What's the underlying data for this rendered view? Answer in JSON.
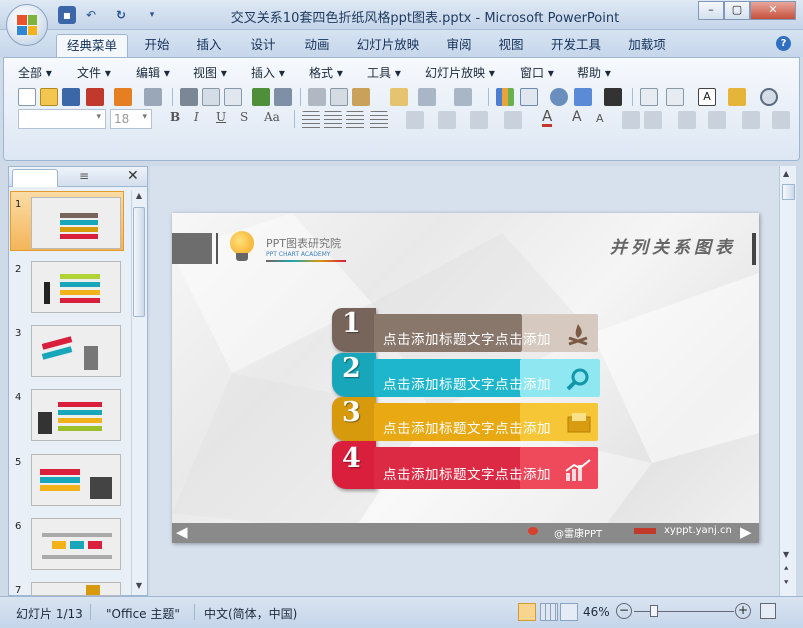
{
  "window": {
    "title": "交叉关系10套四色折纸风格ppt图表.pptx - Microsoft PowerPoint"
  },
  "tabs": [
    {
      "label": "经典菜单",
      "active": true
    },
    {
      "label": "开始"
    },
    {
      "label": "插入"
    },
    {
      "label": "设计"
    },
    {
      "label": "动画"
    },
    {
      "label": "幻灯片放映"
    },
    {
      "label": "审阅"
    },
    {
      "label": "视图"
    },
    {
      "label": "开发工具"
    },
    {
      "label": "加载项"
    }
  ],
  "menus": [
    "全部",
    "文件",
    "编辑",
    "视图",
    "插入",
    "格式",
    "工具",
    "幻灯片放映",
    "窗口",
    "帮助"
  ],
  "toolbar": {
    "font_name": "",
    "font_size": "18"
  },
  "slides_panel": {
    "numbers": [
      "1",
      "2",
      "3",
      "4",
      "5",
      "6",
      "7"
    ]
  },
  "slide": {
    "brand_cn": "PPT图表研究院",
    "brand_en": "PPT CHART ACADEMY",
    "title": "并列关系图表",
    "items": [
      {
        "num": "1",
        "text": "点击添加标题文字点击添加",
        "icon": "fire-icon",
        "color": "#77645a",
        "light": "#d5c9c0"
      },
      {
        "num": "2",
        "text": "点击添加标题文字点击添加",
        "icon": "search-icon",
        "color": "#18a6bb",
        "light": "#9fe8f0"
      },
      {
        "num": "3",
        "text": "点击添加标题文字点击添加",
        "icon": "folder-icon",
        "color": "#d69a0c",
        "light": "#f6c637"
      },
      {
        "num": "4",
        "text": "点击添加标题文字点击添加",
        "icon": "chart-icon",
        "color": "#d91f3b",
        "light": "#ef4a5c"
      }
    ],
    "footer_weibo": "@雷康PPT",
    "footer_url": "xyppt.yanj.cn"
  },
  "status": {
    "slide_pos": "幻灯片 1/13",
    "theme": "\"Office 主题\"",
    "language": "中文(简体，中国)",
    "zoom": "46%"
  }
}
